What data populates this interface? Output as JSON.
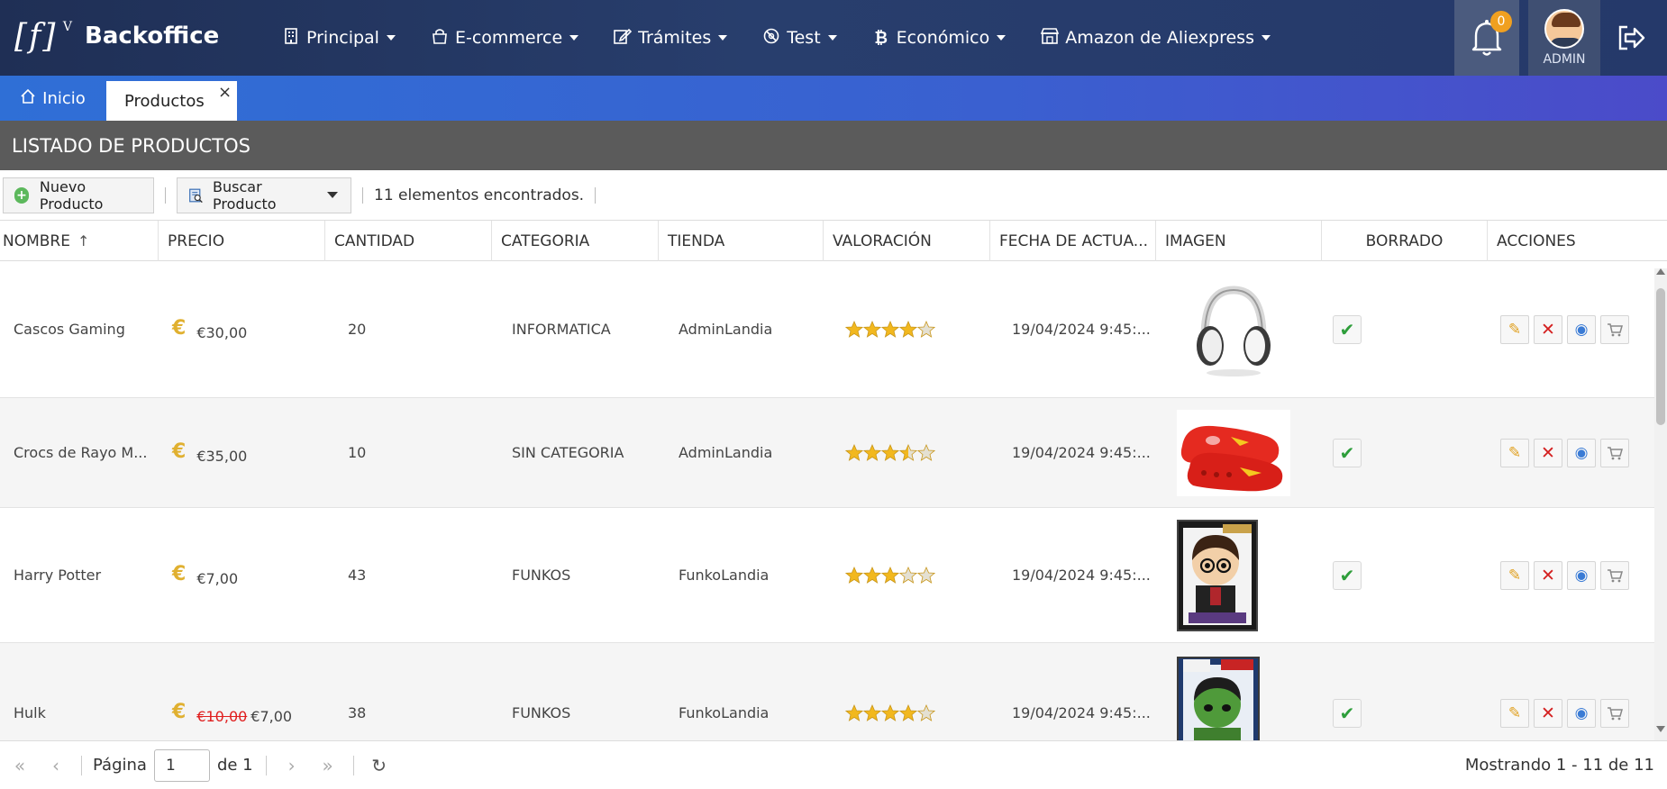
{
  "app": {
    "brand_mark": "[f]",
    "brand_sup": "V",
    "title": "Backoffice"
  },
  "menu": [
    {
      "label": "Principal",
      "icon": "building-icon"
    },
    {
      "label": "E-commerce",
      "icon": "shopping-bag-icon"
    },
    {
      "label": "Trámites",
      "icon": "edit-icon"
    },
    {
      "label": "Test",
      "icon": "test-icon"
    },
    {
      "label": "Económico",
      "icon": "bitcoin-icon"
    },
    {
      "label": "Amazon de Aliexpress",
      "icon": "store-icon"
    }
  ],
  "notifications": {
    "count": "0"
  },
  "user": {
    "label": "ADMIN"
  },
  "tabs": {
    "home": "Inicio",
    "active": "Productos",
    "close": "×"
  },
  "section": {
    "title": "LISTADO DE PRODUCTOS"
  },
  "toolbar": {
    "new_label": "Nuevo Producto",
    "search_label": "Buscar Producto",
    "found": "11 elementos encontrados."
  },
  "columns": [
    "NOMBRE",
    "PRECIO",
    "CANTIDAD",
    "CATEGORIA",
    "TIENDA",
    "VALORACIÓN",
    "FECHA DE ACTUA...",
    "IMAGEN",
    "BORRADO",
    "ACCIONES"
  ],
  "rows": [
    {
      "name": "Cascos Gaming",
      "old_price": "",
      "price": "€30,00",
      "qty": "20",
      "category": "INFORMATICA",
      "store": "AdminLandia",
      "rating": 4,
      "date": "19/04/2024 9:45:...",
      "image": "headphones"
    },
    {
      "name": "Crocs de Rayo M...",
      "old_price": "",
      "price": "€35,00",
      "qty": "10",
      "category": "SIN CATEGORIA",
      "store": "AdminLandia",
      "rating": 3.5,
      "date": "19/04/2024 9:45:...",
      "image": "crocs"
    },
    {
      "name": "Harry Potter",
      "old_price": "",
      "price": "€7,00",
      "qty": "43",
      "category": "FUNKOS",
      "store": "FunkoLandia",
      "rating": 3,
      "date": "19/04/2024 9:45:...",
      "image": "funko-harry"
    },
    {
      "name": "Hulk",
      "old_price": "€10,00",
      "price": "€7,00",
      "qty": "38",
      "category": "FUNKOS",
      "store": "FunkoLandia",
      "rating": 4,
      "date": "19/04/2024 9:45:...",
      "image": "funko-hulk"
    }
  ],
  "pager": {
    "page_label": "Página",
    "page_value": "1",
    "of_label": "de 1",
    "summary": "Mostrando 1 - 11 de 11"
  }
}
